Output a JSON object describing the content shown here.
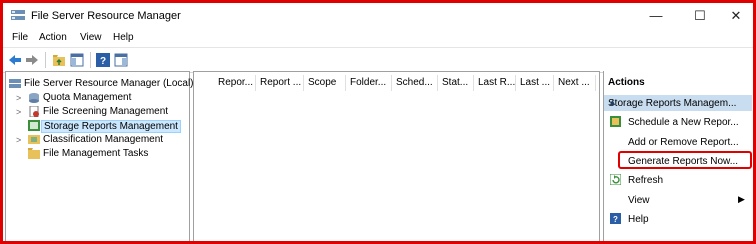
{
  "window": {
    "title": "File Server Resource Manager",
    "minimize": "—",
    "maximize": "☐",
    "close": "✕"
  },
  "menu": [
    "File",
    "Action",
    "View",
    "Help"
  ],
  "tree": {
    "root": "File Server Resource Manager (Local)",
    "items": [
      {
        "label": "Quota Management",
        "expandable": true
      },
      {
        "label": "File Screening Management",
        "expandable": true
      },
      {
        "label": "Storage Reports Management",
        "expandable": false,
        "selected": true
      },
      {
        "label": "Classification Management",
        "expandable": true
      },
      {
        "label": "File Management Tasks",
        "expandable": false
      }
    ]
  },
  "columns": [
    "Repor...",
    "Report ...",
    "Scope",
    "Folder...",
    "Sched...",
    "Stat...",
    "Last R...",
    "Last ...",
    "Next ..."
  ],
  "actions": {
    "title": "Actions",
    "section": "Storage Reports Managem...",
    "items": [
      "Schedule a New Repor...",
      "Add or Remove Report...",
      "Generate Reports Now...",
      "Refresh",
      "View",
      "Help"
    ]
  }
}
